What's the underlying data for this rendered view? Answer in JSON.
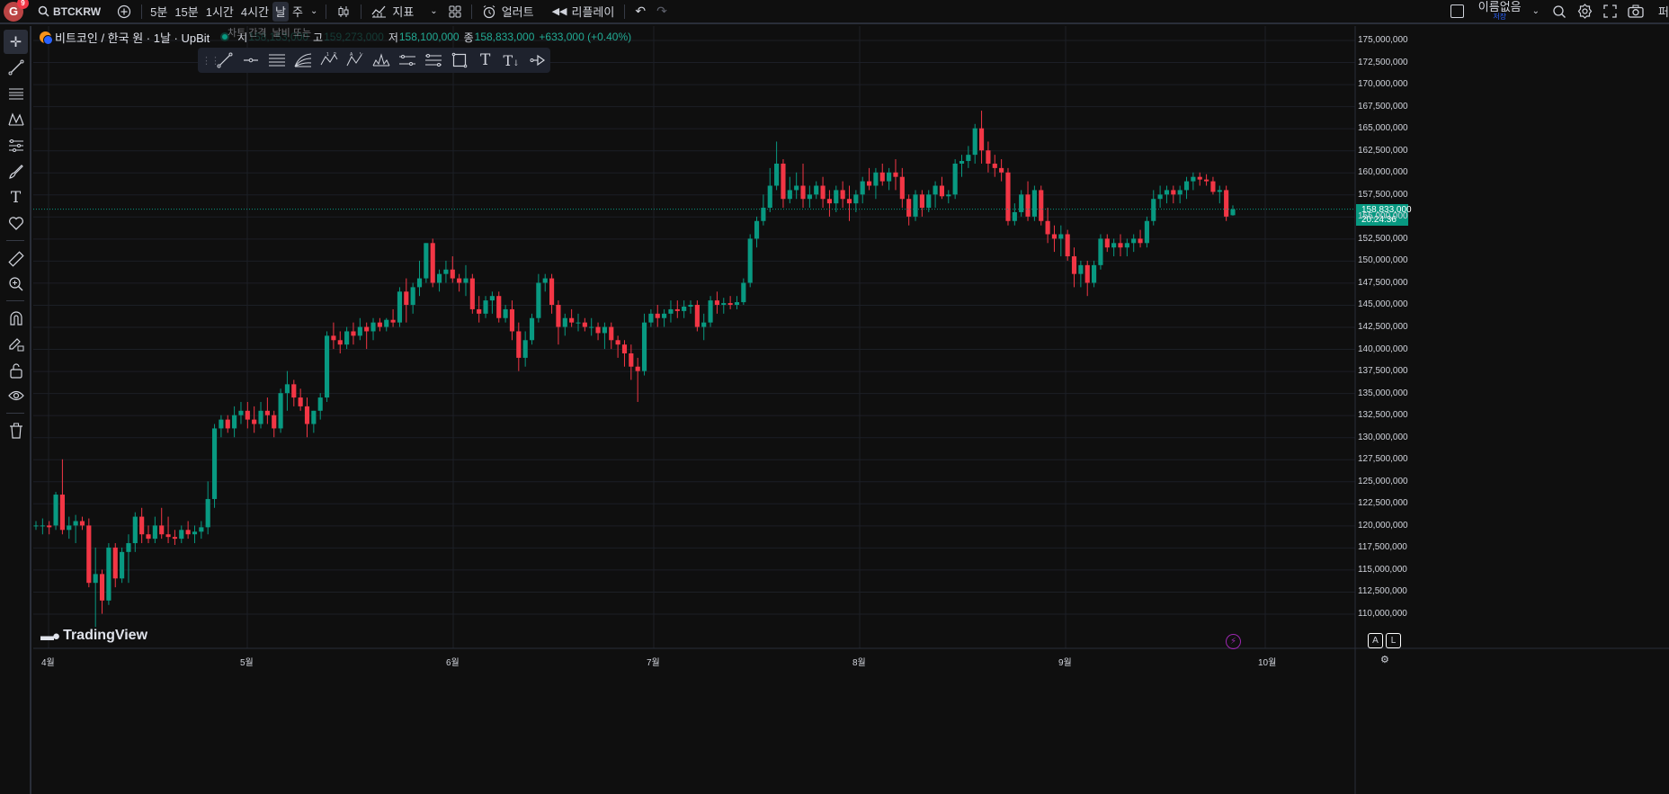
{
  "topbar": {
    "avatar_letter": "G",
    "avatar_badge": "9",
    "symbol": "BTCKRW",
    "intervals": [
      "5분",
      "15분",
      "1시간",
      "4시간",
      "날",
      "주"
    ],
    "selected_interval": "날",
    "indicators_label": "지표",
    "alert_label": "얼러트",
    "replay_label": "리플레이",
    "layout_name": "이름없음",
    "layout_sub": "저장",
    "publish_label": "퍼"
  },
  "legend": {
    "title": "비트코인 / 한국 원 · 1날 · UpBit",
    "open_key": "시",
    "open_val": "158,153,000",
    "high_key": "고",
    "high_val": "159,273,000",
    "low_key": "저",
    "low_val": "158,100,000",
    "close_key": "종",
    "close_val": "158,833,000",
    "change": "+633,000 (+0.40%)"
  },
  "tooltip": {
    "a": "차트 간격",
    "b": "날비 또는"
  },
  "chart_data": {
    "type": "candlestick",
    "x_ticks": [
      "4월",
      "5월",
      "6월",
      "7월",
      "8월",
      "9월",
      "10월"
    ],
    "y_ticks": [
      "175,000,000",
      "172,500,000",
      "170,000,000",
      "167,500,000",
      "165,000,000",
      "162,500,000",
      "160,000,000",
      "157,500,000",
      "155,000,000",
      "152,500,000",
      "150,000,000",
      "147,500,000",
      "145,000,000",
      "142,500,000",
      "140,000,000",
      "137,500,000",
      "135,000,000",
      "132,500,000",
      "130,000,000",
      "127,500,000",
      "125,000,000",
      "122,500,000",
      "120,000,000",
      "117,500,000",
      "115,000,000",
      "112,500,000",
      "110,000,000"
    ],
    "ylim": [
      108650000,
      176300000
    ],
    "last_price": "158,833,000",
    "countdown": "20:24:36",
    "up_color": "#089981",
    "down_color": "#f23645",
    "candles": [
      [
        123000,
        123500,
        122500,
        123000
      ],
      [
        123000,
        123800,
        122000,
        123000
      ],
      [
        123000,
        123500,
        122000,
        122800
      ],
      [
        123000,
        126800,
        122500,
        126500
      ],
      [
        126500,
        130500,
        122000,
        122500
      ],
      [
        122500,
        124000,
        121500,
        123000
      ],
      [
        123000,
        124200,
        121000,
        123500
      ],
      [
        123500,
        124000,
        122500,
        123000
      ],
      [
        123000,
        123800,
        116000,
        116500
      ],
      [
        116500,
        120500,
        111500,
        117500
      ],
      [
        117500,
        118000,
        113000,
        114500
      ],
      [
        114500,
        121000,
        114000,
        120500
      ],
      [
        120500,
        121000,
        116000,
        117000
      ],
      [
        117000,
        120500,
        116500,
        120000
      ],
      [
        120000,
        122000,
        116500,
        121000
      ],
      [
        121000,
        124500,
        120000,
        124000
      ],
      [
        124000,
        125000,
        121000,
        122000
      ],
      [
        122000,
        123000,
        121000,
        121500
      ],
      [
        121500,
        124000,
        121000,
        123000
      ],
      [
        123000,
        125000,
        121500,
        122000
      ],
      [
        122000,
        124000,
        121000,
        121700
      ],
      [
        121700,
        122500,
        120800,
        121500
      ],
      [
        121500,
        123000,
        121000,
        122500
      ],
      [
        122500,
        123500,
        121500,
        122000
      ],
      [
        122000,
        123000,
        121000,
        122300
      ],
      [
        122300,
        123500,
        121500,
        122800
      ],
      [
        122800,
        128000,
        122000,
        126000
      ],
      [
        126000,
        134500,
        125000,
        134000
      ],
      [
        134000,
        135500,
        133000,
        135000
      ],
      [
        135000,
        135500,
        133500,
        134000
      ],
      [
        134000,
        136500,
        133000,
        135500
      ],
      [
        135500,
        137000,
        134500,
        136000
      ],
      [
        136000,
        137000,
        134000,
        135000
      ],
      [
        135000,
        136500,
        133500,
        134500
      ],
      [
        134500,
        137000,
        134000,
        136000
      ],
      [
        136000,
        137500,
        134500,
        135500
      ],
      [
        135500,
        136000,
        133000,
        134000
      ],
      [
        134000,
        138500,
        133500,
        138000
      ],
      [
        138000,
        140500,
        136000,
        139000
      ],
      [
        139000,
        139500,
        136500,
        137500
      ],
      [
        137500,
        138500,
        136000,
        136500
      ],
      [
        136500,
        137500,
        133000,
        134500
      ],
      [
        134500,
        136000,
        133500,
        136000
      ],
      [
        136000,
        138000,
        135000,
        137500
      ],
      [
        137500,
        145000,
        137000,
        144500
      ],
      [
        144500,
        146000,
        143000,
        144000
      ],
      [
        144000,
        145000,
        142500,
        143500
      ],
      [
        143500,
        145500,
        143000,
        145000
      ],
      [
        145000,
        146000,
        143500,
        144500
      ],
      [
        144500,
        146500,
        144000,
        145500
      ],
      [
        145500,
        146000,
        143000,
        145000
      ],
      [
        145000,
        146500,
        144000,
        146000
      ],
      [
        146000,
        146500,
        145000,
        145500
      ],
      [
        145500,
        146500,
        145000,
        146300
      ],
      [
        146300,
        147500,
        145500,
        146000
      ],
      [
        146000,
        150000,
        145500,
        149500
      ],
      [
        149500,
        151000,
        146000,
        148000
      ],
      [
        148000,
        150500,
        147000,
        150000
      ],
      [
        150000,
        153000,
        149000,
        151000
      ],
      [
        151000,
        155000,
        150500,
        155000
      ],
      [
        155000,
        155500,
        150000,
        150500
      ],
      [
        150500,
        152000,
        149500,
        151500
      ],
      [
        151500,
        153000,
        150500,
        152000
      ],
      [
        152000,
        153500,
        150500,
        151000
      ],
      [
        151000,
        151500,
        149500,
        150500
      ],
      [
        150500,
        152500,
        149000,
        151000
      ],
      [
        151000,
        151500,
        147000,
        147500
      ],
      [
        147500,
        149000,
        146000,
        147000
      ],
      [
        147000,
        149000,
        146500,
        148500
      ],
      [
        148500,
        149500,
        147000,
        149000
      ],
      [
        149000,
        149500,
        146000,
        146500
      ],
      [
        146500,
        148000,
        146000,
        147500
      ],
      [
        147500,
        148500,
        144000,
        145000
      ],
      [
        145000,
        146000,
        140500,
        142000
      ],
      [
        142000,
        145000,
        141000,
        144000
      ],
      [
        144000,
        147000,
        143500,
        146500
      ],
      [
        146500,
        151500,
        146000,
        150500
      ],
      [
        150500,
        151500,
        149500,
        151000
      ],
      [
        151000,
        151500,
        147000,
        148000
      ],
      [
        148000,
        148500,
        143500,
        145500
      ],
      [
        145500,
        147000,
        144500,
        146500
      ],
      [
        146500,
        147500,
        145500,
        146000
      ],
      [
        146000,
        147000,
        145000,
        146000
      ],
      [
        146000,
        146500,
        145000,
        145500
      ],
      [
        145500,
        146500,
        144500,
        145500
      ],
      [
        145500,
        146000,
        144000,
        144800
      ],
      [
        144800,
        146000,
        143000,
        145500
      ],
      [
        145500,
        146000,
        143000,
        144000
      ],
      [
        144000,
        144500,
        142000,
        143500
      ],
      [
        143500,
        144000,
        141000,
        142500
      ],
      [
        142500,
        143500,
        139500,
        141000
      ],
      [
        141000,
        142000,
        137000,
        140500
      ],
      [
        140500,
        147000,
        140000,
        146000
      ],
      [
        146000,
        147500,
        145500,
        147000
      ],
      [
        147000,
        148000,
        145500,
        146500
      ],
      [
        146500,
        147500,
        145500,
        147000
      ],
      [
        147000,
        148500,
        146000,
        147500
      ],
      [
        147500,
        148500,
        146500,
        147300
      ],
      [
        147300,
        148500,
        146500,
        147800
      ],
      [
        147800,
        148500,
        147000,
        148000
      ],
      [
        148000,
        148500,
        145000,
        145500
      ],
      [
        145500,
        147000,
        144000,
        146000
      ],
      [
        146000,
        149000,
        145500,
        148500
      ],
      [
        148500,
        149500,
        147000,
        148000
      ],
      [
        148000,
        148800,
        147000,
        148200
      ],
      [
        148200,
        149000,
        147500,
        148000
      ],
      [
        148000,
        149000,
        147500,
        148300
      ],
      [
        148300,
        151000,
        148000,
        150500
      ],
      [
        150500,
        156000,
        150000,
        155500
      ],
      [
        155500,
        158000,
        154500,
        157500
      ],
      [
        157500,
        160500,
        157000,
        159000
      ],
      [
        159000,
        163500,
        158500,
        161500
      ],
      [
        161500,
        166500,
        161000,
        164000
      ],
      [
        164000,
        164500,
        159000,
        160000
      ],
      [
        160000,
        162500,
        159500,
        161000
      ],
      [
        161000,
        163000,
        160000,
        161500
      ],
      [
        161500,
        164000,
        159000,
        160000
      ],
      [
        160000,
        161500,
        159000,
        160500
      ],
      [
        160500,
        162000,
        160000,
        161500
      ],
      [
        161500,
        162500,
        159000,
        160000
      ],
      [
        160000,
        161000,
        158000,
        159500
      ],
      [
        159500,
        161500,
        158500,
        161000
      ],
      [
        161000,
        162000,
        159000,
        160000
      ],
      [
        160000,
        161500,
        157500,
        159500
      ],
      [
        159500,
        161000,
        158500,
        160500
      ],
      [
        160500,
        162500,
        159500,
        162000
      ],
      [
        162000,
        163500,
        161000,
        161500
      ],
      [
        161500,
        163500,
        160000,
        163000
      ],
      [
        163000,
        164000,
        161500,
        162000
      ],
      [
        162000,
        163500,
        161000,
        163000
      ],
      [
        163000,
        164500,
        161000,
        162500
      ],
      [
        162500,
        163500,
        159000,
        160000
      ],
      [
        160000,
        160500,
        157000,
        158000
      ],
      [
        158000,
        161000,
        157500,
        160500
      ],
      [
        160500,
        161000,
        158000,
        159000
      ],
      [
        159000,
        161000,
        158500,
        160500
      ],
      [
        160500,
        162000,
        159000,
        161500
      ],
      [
        161500,
        162500,
        160000,
        160300
      ],
      [
        160300,
        161000,
        159500,
        160500
      ],
      [
        160500,
        164500,
        160000,
        164000
      ],
      [
        164000,
        165000,
        162500,
        164300
      ],
      [
        164300,
        166000,
        163500,
        165000
      ],
      [
        165000,
        168500,
        164000,
        168000
      ],
      [
        168000,
        170000,
        164000,
        165500
      ],
      [
        165500,
        166500,
        163000,
        164000
      ],
      [
        164000,
        165000,
        162500,
        163500
      ],
      [
        163500,
        164500,
        162000,
        163000
      ],
      [
        163000,
        163500,
        157000,
        157500
      ],
      [
        157500,
        159500,
        157000,
        158500
      ],
      [
        158500,
        161000,
        158000,
        160500
      ],
      [
        160500,
        162000,
        157500,
        158000
      ],
      [
        158000,
        161500,
        157500,
        161000
      ],
      [
        161000,
        161500,
        157000,
        157500
      ],
      [
        157500,
        159000,
        155000,
        156000
      ],
      [
        156000,
        157000,
        154000,
        155500
      ],
      [
        155500,
        157000,
        153500,
        156000
      ],
      [
        156000,
        156500,
        153000,
        153500
      ],
      [
        153500,
        154500,
        150000,
        151500
      ],
      [
        151500,
        153000,
        150000,
        152500
      ],
      [
        152500,
        153000,
        149000,
        150500
      ],
      [
        150500,
        153000,
        150000,
        152500
      ],
      [
        152500,
        156000,
        152000,
        155500
      ],
      [
        155500,
        156000,
        154000,
        154500
      ],
      [
        154500,
        155500,
        153500,
        155000
      ],
      [
        155000,
        156000,
        153500,
        154500
      ],
      [
        154500,
        155500,
        153500,
        155000
      ],
      [
        155000,
        156000,
        154000,
        155500
      ],
      [
        155500,
        156500,
        154500,
        155000
      ],
      [
        155000,
        158000,
        154500,
        157500
      ],
      [
        157500,
        161000,
        157000,
        160000
      ],
      [
        160000,
        161500,
        159000,
        160500
      ],
      [
        160500,
        161500,
        159500,
        161000
      ],
      [
        161000,
        161500,
        159500,
        160500
      ],
      [
        160500,
        161500,
        159500,
        161000
      ],
      [
        161000,
        162500,
        160000,
        162000
      ],
      [
        162000,
        163000,
        161000,
        162500
      ],
      [
        162500,
        163000,
        161500,
        162200
      ],
      [
        162200,
        162800,
        161500,
        162000
      ],
      [
        162000,
        162500,
        160500,
        160800
      ],
      [
        160800,
        161500,
        159500,
        161000
      ],
      [
        161000,
        161500,
        157500,
        158000
      ],
      [
        158153,
        159273,
        158100,
        158833
      ]
    ]
  },
  "watermark": "TradingView",
  "bottom": {
    "a_label": "A",
    "l_label": "L"
  }
}
